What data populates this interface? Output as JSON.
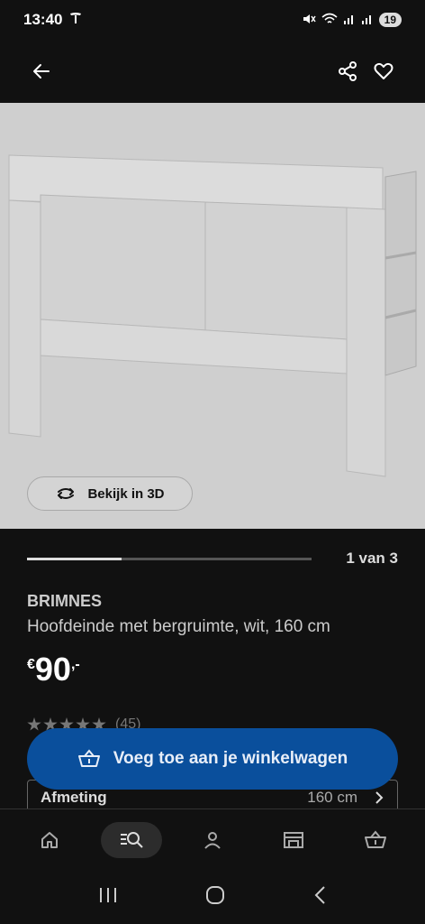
{
  "status": {
    "time": "13:40",
    "battery": "19"
  },
  "product": {
    "view3d_label": "Bekijk in 3D",
    "gallery_progress": {
      "current": 1,
      "total": 3,
      "text": "1 van 3"
    },
    "brand": "BRIMNES",
    "description": "Hoofdeinde met bergruimte, wit, 160 cm",
    "price": {
      "currency": "€",
      "amount": "90",
      "decimals": ",-"
    },
    "rating": {
      "stars": 4.5,
      "count_text": "(45)"
    },
    "size": {
      "label": "Afmeting",
      "value": "160 cm"
    }
  },
  "cart_button_label": "Voeg toe aan je winkelwagen",
  "bottom_nav": [
    "home-icon",
    "search-icon",
    "account-icon",
    "store-icon",
    "cart-icon"
  ],
  "colors": {
    "primary": "#0a4f9c",
    "background": "#111111"
  }
}
